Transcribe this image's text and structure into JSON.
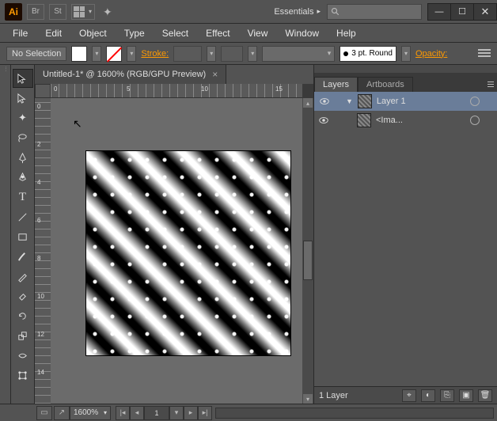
{
  "app": {
    "logo_text": "Ai",
    "workspace": "Essentials"
  },
  "menu": [
    "File",
    "Edit",
    "Object",
    "Type",
    "Select",
    "Effect",
    "View",
    "Window",
    "Help"
  ],
  "options": {
    "selection": "No Selection",
    "stroke_label": "Stroke:",
    "brush_profile": "3 pt. Round",
    "opacity_label": "Opacity:"
  },
  "document": {
    "tab_title": "Untitled-1* @ 1600% (RGB/GPU Preview)",
    "ruler_h": [
      "0",
      "5",
      "10",
      "15"
    ],
    "ruler_v": [
      "0",
      "2",
      "4",
      "6",
      "8",
      "10",
      "12",
      "14"
    ]
  },
  "panels": {
    "tabs": {
      "layers": "Layers",
      "artboards": "Artboards"
    },
    "layers": [
      {
        "name": "Layer 1"
      },
      {
        "name": "<Ima..."
      }
    ],
    "status_count": "1 Layer"
  },
  "status": {
    "zoom": "1600%",
    "artboard_index": "1"
  },
  "icons": {
    "bridge": "Br",
    "stock": "St",
    "tools": [
      "selection",
      "direct-selection",
      "magic-wand",
      "lasso",
      "pen",
      "curvature",
      "type",
      "line",
      "rectangle",
      "paintbrush",
      "pencil",
      "eraser",
      "rotate",
      "scale",
      "width",
      "free-transform"
    ]
  }
}
